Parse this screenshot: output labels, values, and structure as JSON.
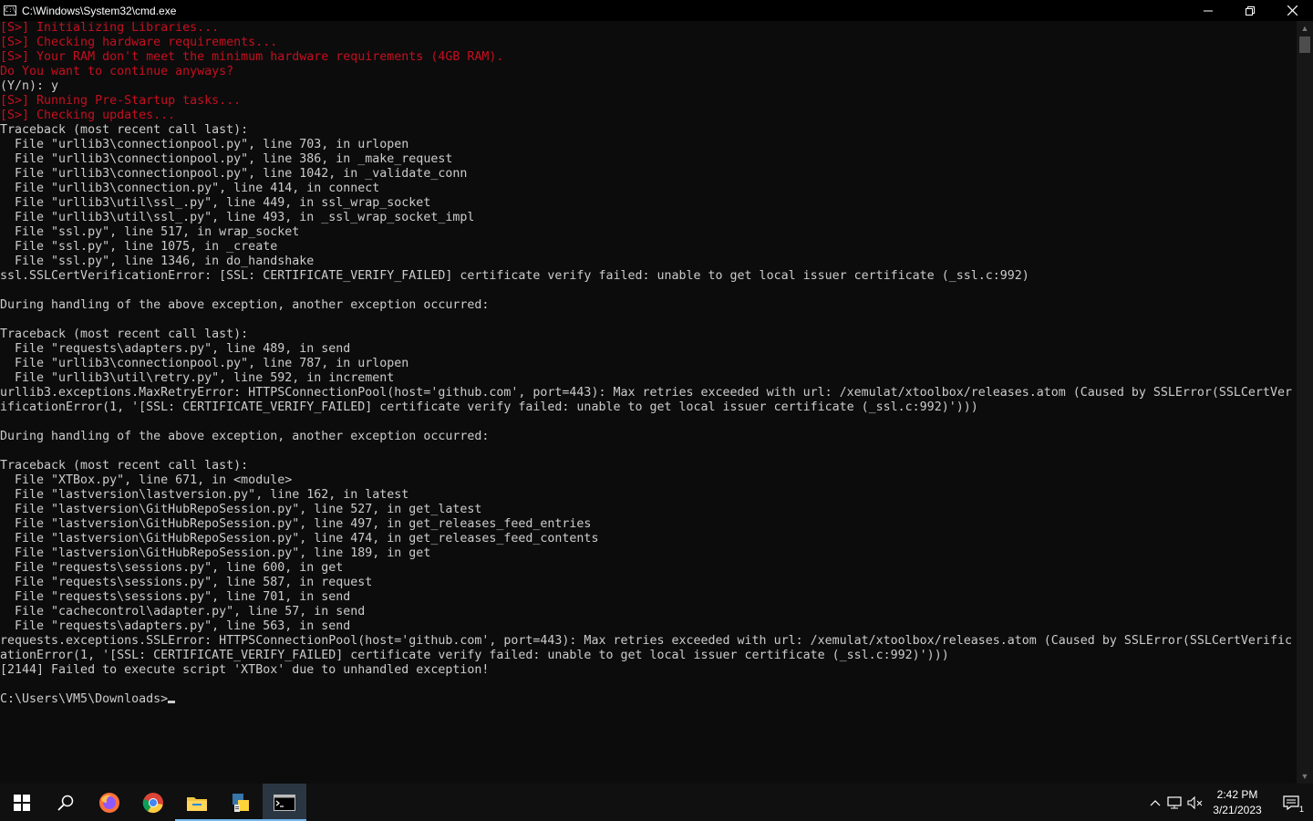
{
  "window": {
    "title": "C:\\Windows\\System32\\cmd.exe",
    "icon_text": "C:\\"
  },
  "console": {
    "lines": [
      {
        "text": "[S>] Initializing Libraries...",
        "color": "red"
      },
      {
        "text": "[S>] Checking hardware requirements...",
        "color": "red"
      },
      {
        "text": "[S>] Your RAM don't meet the minimum hardware requirements (4GB RAM).",
        "color": "red"
      },
      {
        "text": "Do You want to continue anyways?",
        "color": "red"
      },
      {
        "text": "(Y/n): y",
        "color": "gray"
      },
      {
        "text": "[S>] Running Pre-Startup tasks...",
        "color": "red"
      },
      {
        "text": "[S>] Checking updates...",
        "color": "red"
      },
      {
        "text": "Traceback (most recent call last):",
        "color": "gray"
      },
      {
        "text": "  File \"urllib3\\connectionpool.py\", line 703, in urlopen",
        "color": "gray"
      },
      {
        "text": "  File \"urllib3\\connectionpool.py\", line 386, in _make_request",
        "color": "gray"
      },
      {
        "text": "  File \"urllib3\\connectionpool.py\", line 1042, in _validate_conn",
        "color": "gray"
      },
      {
        "text": "  File \"urllib3\\connection.py\", line 414, in connect",
        "color": "gray"
      },
      {
        "text": "  File \"urllib3\\util\\ssl_.py\", line 449, in ssl_wrap_socket",
        "color": "gray"
      },
      {
        "text": "  File \"urllib3\\util\\ssl_.py\", line 493, in _ssl_wrap_socket_impl",
        "color": "gray"
      },
      {
        "text": "  File \"ssl.py\", line 517, in wrap_socket",
        "color": "gray"
      },
      {
        "text": "  File \"ssl.py\", line 1075, in _create",
        "color": "gray"
      },
      {
        "text": "  File \"ssl.py\", line 1346, in do_handshake",
        "color": "gray"
      },
      {
        "text": "ssl.SSLCertVerificationError: [SSL: CERTIFICATE_VERIFY_FAILED] certificate verify failed: unable to get local issuer certificate (_ssl.c:992)",
        "color": "gray"
      },
      {
        "text": "",
        "color": "gray"
      },
      {
        "text": "During handling of the above exception, another exception occurred:",
        "color": "gray"
      },
      {
        "text": "",
        "color": "gray"
      },
      {
        "text": "Traceback (most recent call last):",
        "color": "gray"
      },
      {
        "text": "  File \"requests\\adapters.py\", line 489, in send",
        "color": "gray"
      },
      {
        "text": "  File \"urllib3\\connectionpool.py\", line 787, in urlopen",
        "color": "gray"
      },
      {
        "text": "  File \"urllib3\\util\\retry.py\", line 592, in increment",
        "color": "gray"
      },
      {
        "text": "urllib3.exceptions.MaxRetryError: HTTPSConnectionPool(host='github.com', port=443): Max retries exceeded with url: /xemulat/xtoolbox/releases.atom (Caused by SSLError(SSLCertVer",
        "color": "gray"
      },
      {
        "text": "ificationError(1, '[SSL: CERTIFICATE_VERIFY_FAILED] certificate verify failed: unable to get local issuer certificate (_ssl.c:992)')))",
        "color": "gray"
      },
      {
        "text": "",
        "color": "gray"
      },
      {
        "text": "During handling of the above exception, another exception occurred:",
        "color": "gray"
      },
      {
        "text": "",
        "color": "gray"
      },
      {
        "text": "Traceback (most recent call last):",
        "color": "gray"
      },
      {
        "text": "  File \"XTBox.py\", line 671, in <module>",
        "color": "gray"
      },
      {
        "text": "  File \"lastversion\\lastversion.py\", line 162, in latest",
        "color": "gray"
      },
      {
        "text": "  File \"lastversion\\GitHubRepoSession.py\", line 527, in get_latest",
        "color": "gray"
      },
      {
        "text": "  File \"lastversion\\GitHubRepoSession.py\", line 497, in get_releases_feed_entries",
        "color": "gray"
      },
      {
        "text": "  File \"lastversion\\GitHubRepoSession.py\", line 474, in get_releases_feed_contents",
        "color": "gray"
      },
      {
        "text": "  File \"lastversion\\GitHubRepoSession.py\", line 189, in get",
        "color": "gray"
      },
      {
        "text": "  File \"requests\\sessions.py\", line 600, in get",
        "color": "gray"
      },
      {
        "text": "  File \"requests\\sessions.py\", line 587, in request",
        "color": "gray"
      },
      {
        "text": "  File \"requests\\sessions.py\", line 701, in send",
        "color": "gray"
      },
      {
        "text": "  File \"cachecontrol\\adapter.py\", line 57, in send",
        "color": "gray"
      },
      {
        "text": "  File \"requests\\adapters.py\", line 563, in send",
        "color": "gray"
      },
      {
        "text": "requests.exceptions.SSLError: HTTPSConnectionPool(host='github.com', port=443): Max retries exceeded with url: /xemulat/xtoolbox/releases.atom (Caused by SSLError(SSLCertVerific",
        "color": "gray"
      },
      {
        "text": "ationError(1, '[SSL: CERTIFICATE_VERIFY_FAILED] certificate verify failed: unable to get local issuer certificate (_ssl.c:992)')))",
        "color": "gray"
      },
      {
        "text": "[2144] Failed to execute script 'XTBox' due to unhandled exception!",
        "color": "gray"
      },
      {
        "text": "",
        "color": "gray"
      }
    ],
    "prompt": "C:\\Users\\VM5\\Downloads>"
  },
  "colors": {
    "red": "#c50f1f",
    "gray": "#cccccc",
    "background": "#0c0c0c"
  },
  "taskbar": {
    "icons": [
      "start-icon",
      "search-icon",
      "firefox-icon",
      "chrome-icon",
      "file-explorer-icon",
      "python-script-icon",
      "cmd-icon"
    ]
  },
  "tray": {
    "time": "2:42 PM",
    "date": "3/21/2023",
    "notification_count": "1"
  }
}
